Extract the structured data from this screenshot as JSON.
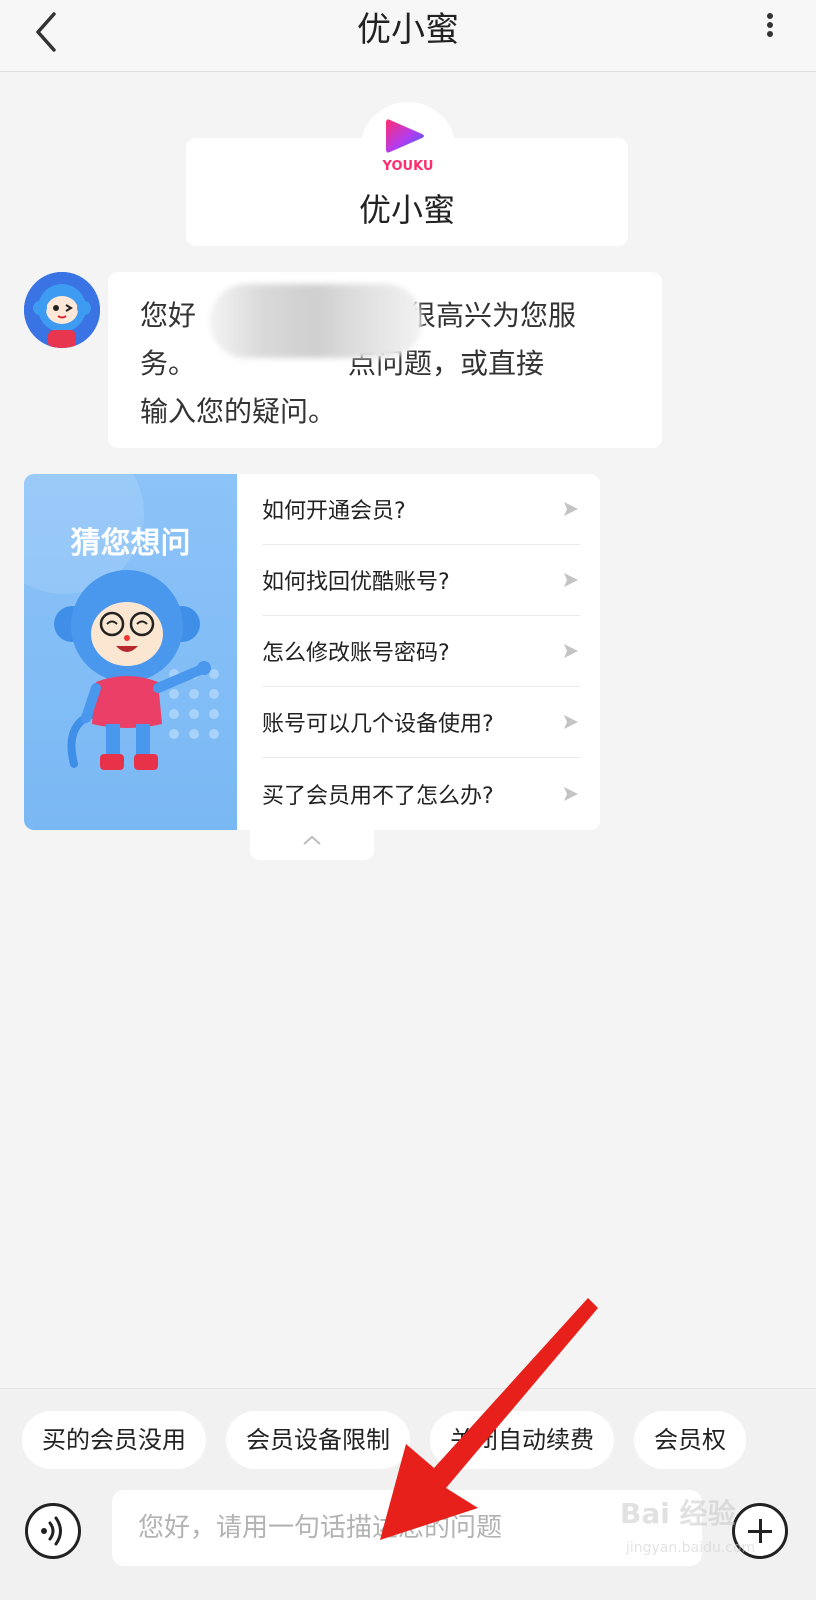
{
  "header": {
    "title": "优小蜜",
    "back_icon": "chevron-left-icon",
    "more_icon": "more-vertical-icon"
  },
  "brand": {
    "logo_text": "YOUKU",
    "name": "优小蜜",
    "colors": {
      "pink": "#ff2d6e",
      "blue": "#2f6cf0",
      "purple": "#7a3cf2"
    }
  },
  "greeting": {
    "line1_a": "您好",
    "line1_b": "很高兴为您服",
    "line2_a": "务。",
    "line2_b": "点问题，或直接",
    "line3": "输入您的疑问。"
  },
  "faq": {
    "banner_title": "猜您想问",
    "items": [
      "如何开通会员?",
      "如何找回优酷账号?",
      "怎么修改账号密码?",
      "账号可以几个设备使用?",
      "买了会员用不了怎么办?"
    ]
  },
  "quick_chips": [
    "买的会员没用",
    "会员设备限制",
    "关闭自动续费",
    "会员权"
  ],
  "input": {
    "placeholder": "您好，请用一句话描述您的问题"
  },
  "watermark": {
    "main": "Bai 经验",
    "sub": "jingyan.baidu.com"
  },
  "annotation_color": "#e8201b"
}
